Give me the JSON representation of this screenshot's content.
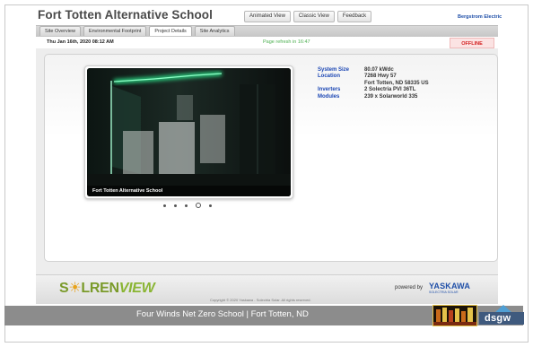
{
  "header": {
    "title": "Fort Totten Alternative School",
    "nav": [
      "Animated View",
      "Classic View",
      "Feedback"
    ],
    "brand_link": "Bergstrom Electric"
  },
  "tabs": [
    {
      "label": "Site Overview",
      "active": false
    },
    {
      "label": "Environmental Footprint",
      "active": false
    },
    {
      "label": "Project Details",
      "active": true
    },
    {
      "label": "Site Analytics",
      "active": false
    }
  ],
  "status": {
    "datetime": "Thu Jan 16th, 2020 08:12 AM",
    "refresh": "Page refresh in 16:47",
    "state": "OFFLINE",
    "state_color": "#d32020"
  },
  "photo": {
    "caption": "Fort Totten Alternative School",
    "slides": 5,
    "active_slide": 4
  },
  "specs": [
    {
      "label": "System Size",
      "value": "80.07 kWdc"
    },
    {
      "label": "Location",
      "value": "7268 Hwy 57"
    },
    {
      "label": "",
      "value": "Fort Totten, ND 58335 US"
    },
    {
      "label": "Inverters",
      "value": "2 Solectria PVI 36TL"
    },
    {
      "label": "Modules",
      "value": "239 x Solarworld 335"
    }
  ],
  "footer": {
    "logo_a": "S",
    "logo_sun": "☀",
    "logo_b": "LREN",
    "logo_c": "VIEW",
    "powered_by": "powered by",
    "partner": "YASKAWA",
    "partner_sub": "SOLECTRIA SOLAR",
    "copyright": "Copyright © 2020 Yaskawa - Solectria Solar. All rights reserved."
  },
  "banner": {
    "text": "Four Winds Net Zero School  |  Fort Totten, ND",
    "dsgw": "dsgw",
    "colors": {
      "strip": "#8c8c8c",
      "dsgw": "#3f5a7e",
      "roof": "#4f9fd4"
    }
  },
  "colors": {
    "accent_blue": "#1c47b4",
    "refresh_green": "#4caf50",
    "glow_green": "#2dff9a"
  }
}
